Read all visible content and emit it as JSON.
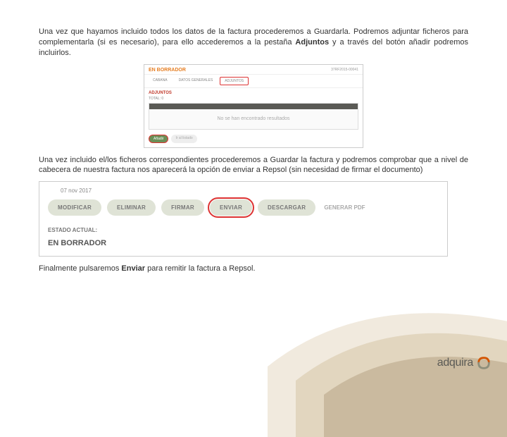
{
  "para1_a": "Una vez que hayamos incluido todos los datos de la factura procederemos a Guardarla. Podremos adjuntar ficheros para complementarla (si es necesario), para ello accederemos a la pestaña ",
  "para1_b": "Adjuntos",
  "para1_c": " y a través del botón añadir podremos incluirlos.",
  "shot1": {
    "badge": "EN BORRADOR",
    "ref": "37RF2015-00041",
    "tabs": [
      "CABANA",
      "DATOS GENERALES",
      "ADJUNTOS"
    ],
    "section": "ADJUNTOS",
    "total": "TOTAL: 0",
    "empty": "No se han encontrado resultados",
    "add": "Añadir",
    "back": "Ir al listado"
  },
  "para2": "Una vez incluido el/los ficheros correspondientes procederemos a Guardar la factura y podremos comprobar que a nivel de cabecera de nuestra factura nos aparecerá la opción de enviar a Repsol (sin necesidad de firmar el documento)",
  "shot2": {
    "date": "07 nov 2017",
    "buttons": [
      "MODIFICAR",
      "ELIMINAR",
      "FIRMAR",
      "ENVIAR",
      "DESCARGAR"
    ],
    "generar": "GENERAR PDF",
    "estado_label": "ESTADO ACTUAL:",
    "estado_value": "EN BORRADOR"
  },
  "para3_a": "Finalmente pulsaremos ",
  "para3_b": "Enviar",
  "para3_c": " para remitir la factura a Repsol.",
  "brand": "adquira"
}
